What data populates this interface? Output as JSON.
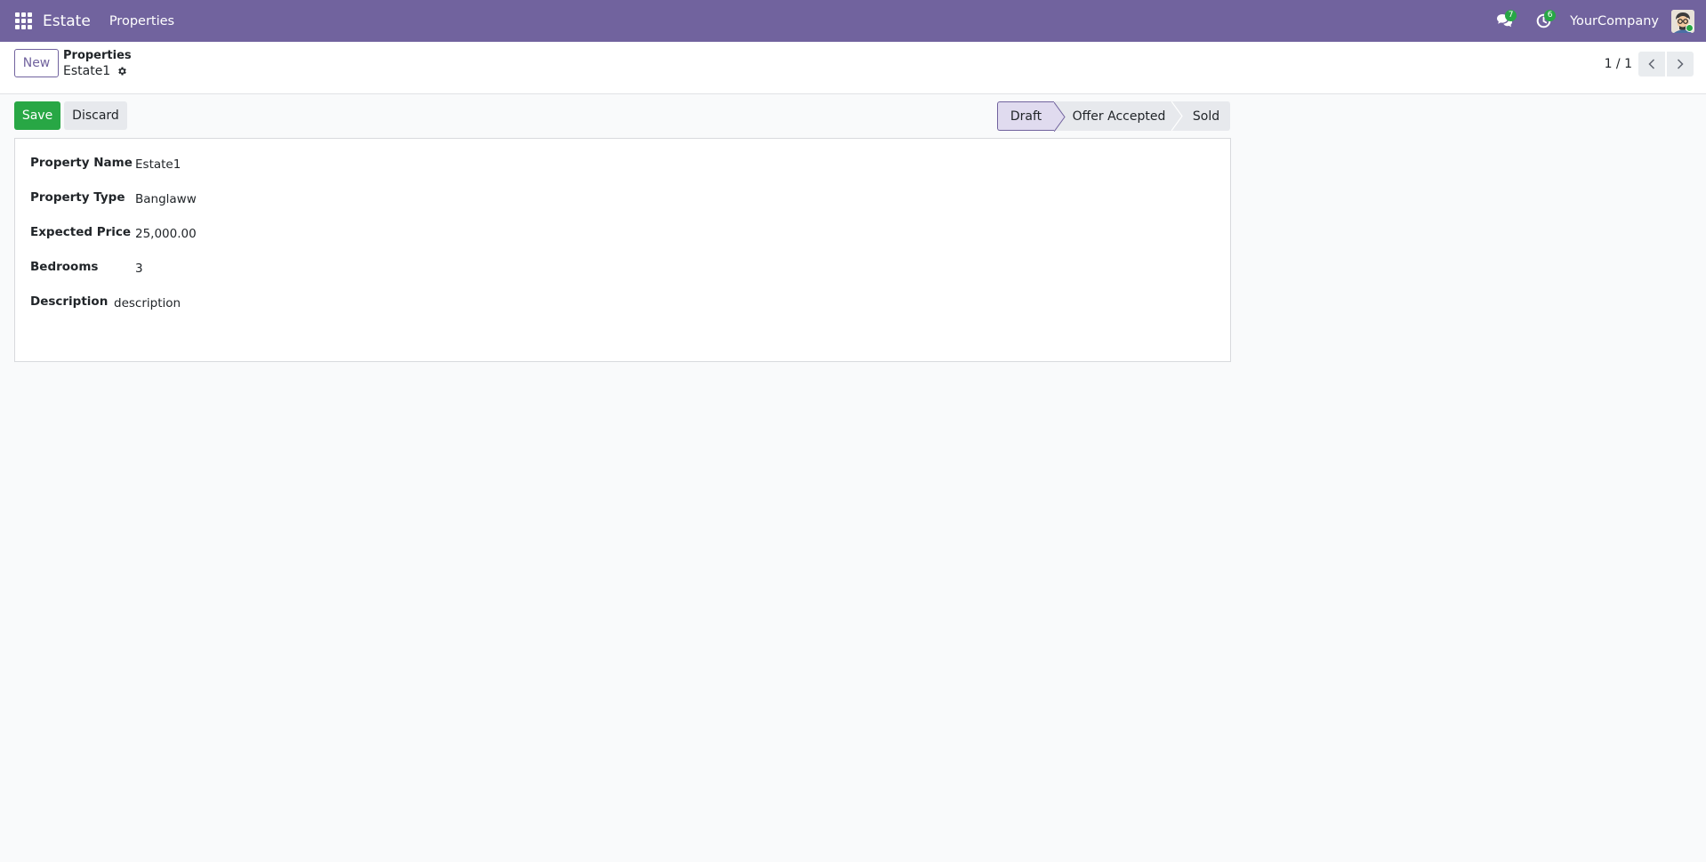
{
  "navbar": {
    "app_name": "Estate",
    "menu": [
      "Properties"
    ],
    "messages_badge": "7",
    "activities_badge": "6",
    "company": "YourCompany",
    "color": "#71639e"
  },
  "control_panel": {
    "new_label": "New",
    "breadcrumb_parent": "Properties",
    "breadcrumb_current": "Estate1",
    "pager": "1 / 1"
  },
  "form": {
    "save_label": "Save",
    "discard_label": "Discard",
    "stages": [
      "Draft",
      "Offer Accepted",
      "Sold"
    ],
    "active_stage": "Draft",
    "fields": [
      {
        "label": "Property Name",
        "value": "Estate1"
      },
      {
        "label": "Property Type",
        "value": "Banglaww"
      },
      {
        "label": "Expected Price",
        "value": "25,000.00"
      },
      {
        "label": "Bedrooms",
        "value": "3"
      },
      {
        "label": "Description",
        "value": "description"
      }
    ]
  },
  "icons": [
    "apps-grid-icon",
    "chat-icon",
    "clock-icon",
    "gear-icon",
    "chevron-left-icon",
    "chevron-right-icon"
  ]
}
